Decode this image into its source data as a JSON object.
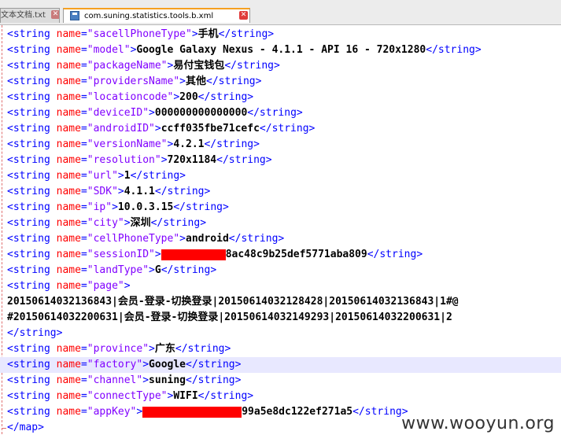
{
  "tabs": [
    {
      "label": "文本文档.txt",
      "close": "✕",
      "active": false
    },
    {
      "label": "com.suning.statistics.tools.b.xml",
      "close": "✕",
      "active": true
    }
  ],
  "entries": [
    {
      "name": "sacellPhoneType",
      "value": "手机"
    },
    {
      "name": "model",
      "value": "Google Galaxy Nexus - 4.1.1 - API 16 - 720x1280"
    },
    {
      "name": "packageName",
      "value": "易付宝钱包"
    },
    {
      "name": "providersName",
      "value": "其他"
    },
    {
      "name": "locationcode",
      "value": "200"
    },
    {
      "name": "deviceID",
      "value": "000000000000000"
    },
    {
      "name": "androidID",
      "value": "ccff035fbe71cefc"
    },
    {
      "name": "versionName",
      "value": "4.2.1"
    },
    {
      "name": "resolution",
      "value": "720x1184"
    },
    {
      "name": "url",
      "value": "1"
    },
    {
      "name": "SDK",
      "value": "4.1.1"
    },
    {
      "name": "ip",
      "value": "10.0.3.15"
    },
    {
      "name": "city",
      "value": "深圳"
    },
    {
      "name": "cellPhoneType",
      "value": "android"
    },
    {
      "name": "sessionID",
      "value_suffix": "8ac48c9b25def5771aba809",
      "redacted": true
    },
    {
      "name": "landType",
      "value": "G"
    },
    {
      "name": "page",
      "value_lines": [
        "20150614032136843|会员-登录-切换登录|20150614032128428|20150614032136843|1#@",
        "#20150614032200631|会员-登录-切换登录|20150614032149293|20150614032200631|2"
      ]
    },
    {
      "name": "province",
      "value": "广东"
    },
    {
      "name": "factory",
      "value": "Google",
      "highlight": true
    },
    {
      "name": "channel",
      "value": "suning"
    },
    {
      "name": "connectType",
      "value": "WIFI"
    },
    {
      "name": "appKey",
      "value_suffix": "99a5e8dc122ef271a5",
      "redacted": true
    }
  ],
  "closing_tag": "</map>",
  "watermark": "www.wooyun.org"
}
